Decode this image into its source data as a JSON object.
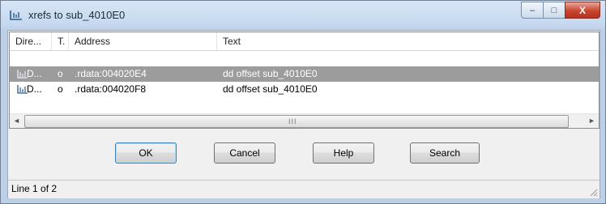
{
  "window": {
    "title": "xrefs to sub_4010E0",
    "controls": {
      "minimize": "–",
      "maximize": "□",
      "close": "X"
    }
  },
  "list": {
    "columns": [
      "Dire...",
      "T.",
      "Address",
      "Text"
    ],
    "rows": [
      {
        "direction": "D...",
        "type": "o",
        "address": ".rdata:004020E4",
        "text": "dd offset sub_4010E0",
        "selected": true
      },
      {
        "direction": "D...",
        "type": "o",
        "address": ".rdata:004020F8",
        "text": "dd offset sub_4010E0",
        "selected": false
      }
    ],
    "scroll_grip": "III"
  },
  "buttons": {
    "ok": "OK",
    "cancel": "Cancel",
    "help": "Help",
    "search": "Search"
  },
  "status": {
    "text": "Line 1 of 2"
  },
  "icons": {
    "title": "xref-icon",
    "row": "xref-icon"
  }
}
